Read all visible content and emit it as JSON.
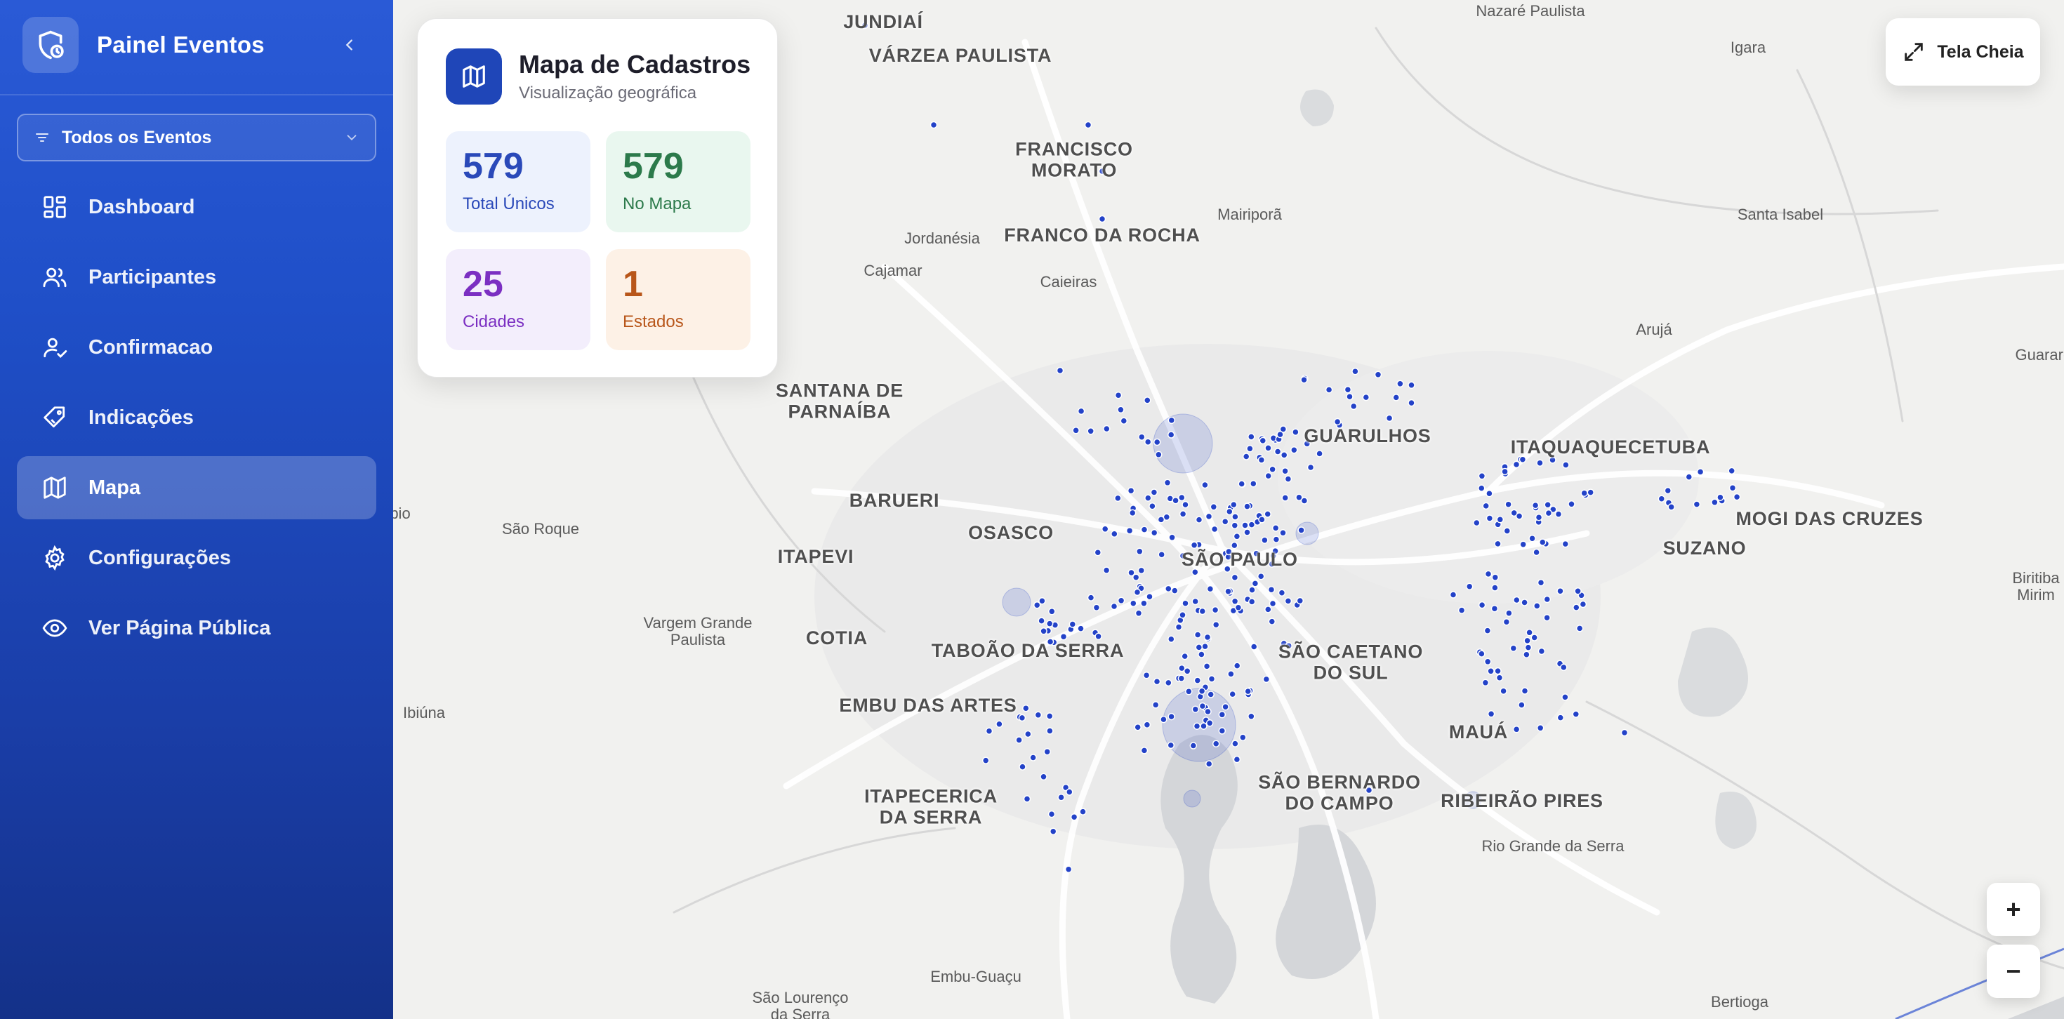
{
  "sidebar": {
    "brand": "Painel Eventos",
    "event_filter": "Todos os Eventos",
    "items": [
      {
        "label": "Dashboard",
        "icon": "dashboard-icon",
        "active": false
      },
      {
        "label": "Participantes",
        "icon": "users-icon",
        "active": false
      },
      {
        "label": "Confirmacao",
        "icon": "user-check-icon",
        "active": false
      },
      {
        "label": "Indicações",
        "icon": "tag-icon",
        "active": false
      },
      {
        "label": "Mapa",
        "icon": "map-icon",
        "active": true
      },
      {
        "label": "Configurações",
        "icon": "gear-icon",
        "active": false
      },
      {
        "label": "Ver Página Pública",
        "icon": "eye-icon",
        "active": false
      }
    ]
  },
  "card": {
    "title": "Mapa de Cadastros",
    "subtitle": "Visualização geográfica",
    "stats": {
      "total": {
        "value": "579",
        "label": "Total Únicos"
      },
      "on_map": {
        "value": "579",
        "label": "No Mapa"
      },
      "cities": {
        "value": "25",
        "label": "Cidades"
      },
      "states": {
        "value": "1",
        "label": "Estados"
      }
    }
  },
  "controls": {
    "fullscreen": "Tela Cheia",
    "zoom_in": "+",
    "zoom_out": "−"
  },
  "map": {
    "marker_color": "#2342c8",
    "places": [
      {
        "name": "JUNDIAÍ",
        "major": true
      },
      {
        "name": "VÁRZEA PAULISTA",
        "major": true
      },
      {
        "name": "Nazaré Paulista",
        "major": false
      },
      {
        "name": "Igara",
        "major": false
      },
      {
        "name": "FRANCISCO\nMORATO",
        "major": true
      },
      {
        "name": "Mairiporã",
        "major": false
      },
      {
        "name": "Santa Isabel",
        "major": false
      },
      {
        "name": "Jordanésia",
        "major": false
      },
      {
        "name": "FRANCO DA ROCHA",
        "major": true
      },
      {
        "name": "Cajamar",
        "major": false
      },
      {
        "name": "Caieiras",
        "major": false
      },
      {
        "name": "Arujá",
        "major": false
      },
      {
        "name": "Guararem",
        "major": false
      },
      {
        "name": "SANTANA DE\nPARNAÍBA",
        "major": true
      },
      {
        "name": "GUARULHOS",
        "major": true
      },
      {
        "name": "ITAQUAQUECETUBA",
        "major": true
      },
      {
        "name": "BARUERI",
        "major": true
      },
      {
        "name": "MOGI DAS CRUZES",
        "major": true
      },
      {
        "name": "São Roque",
        "major": false
      },
      {
        "name": "OSASCO",
        "major": true
      },
      {
        "name": "SUZANO",
        "major": true
      },
      {
        "name": "ITAPEVI",
        "major": true
      },
      {
        "name": "SÃO PAULO",
        "major": true
      },
      {
        "name": "Biritiba Mirim",
        "major": false
      },
      {
        "name": "Vargem Grande\nPaulista",
        "major": false
      },
      {
        "name": "COTIA",
        "major": true
      },
      {
        "name": "TABOÃO DA SERRA",
        "major": true
      },
      {
        "name": "SÃO CAETANO\nDO SUL",
        "major": true
      },
      {
        "name": "Ibiúna",
        "major": false
      },
      {
        "name": "EMBU DAS ARTES",
        "major": true
      },
      {
        "name": "MAUÁ",
        "major": true
      },
      {
        "name": "ITAPECERICA\nDA SERRA",
        "major": true
      },
      {
        "name": "SÃO BERNARDO\nDO CAMPO",
        "major": true
      },
      {
        "name": "RIBEIRÃO PIRES",
        "major": true
      },
      {
        "name": "Rio Grande da Serra",
        "major": false
      },
      {
        "name": "Embu-Guaçu",
        "major": false
      },
      {
        "name": "São Lourenço\nda Serra",
        "major": false
      },
      {
        "name": "Bertioga",
        "major": false
      },
      {
        "name": "pio",
        "major": false
      }
    ]
  }
}
